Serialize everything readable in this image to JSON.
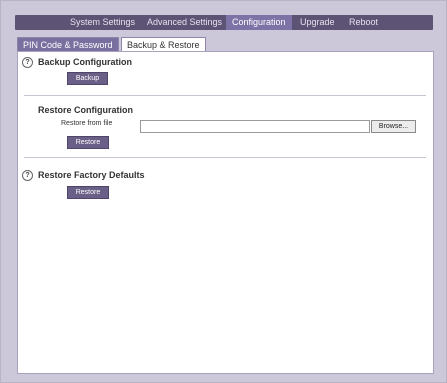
{
  "nav": {
    "items": [
      {
        "label": "System Settings",
        "active": false
      },
      {
        "label": "Advanced Settings",
        "active": false
      },
      {
        "label": "Configuration",
        "active": true
      },
      {
        "label": "Upgrade",
        "active": false
      },
      {
        "label": "Reboot",
        "active": false
      }
    ]
  },
  "subtabs": {
    "pin": "PIN Code & Password",
    "backup_restore": "Backup & Restore"
  },
  "backup": {
    "title": "Backup Configuration",
    "button": "Backup"
  },
  "restore": {
    "title": "Restore Configuration",
    "file_label": "Restore from file",
    "file_value": "",
    "browse": "Browse...",
    "button": "Restore"
  },
  "factory": {
    "title": "Restore Factory Defaults",
    "button": "Restore"
  },
  "help_glyph": "?",
  "colors": {
    "navbar": "#5d5475",
    "nav_active": "#7e73a6",
    "button": "#6a5f86",
    "background": "#cdc8d9"
  },
  "icons": [
    "help-icon"
  ]
}
